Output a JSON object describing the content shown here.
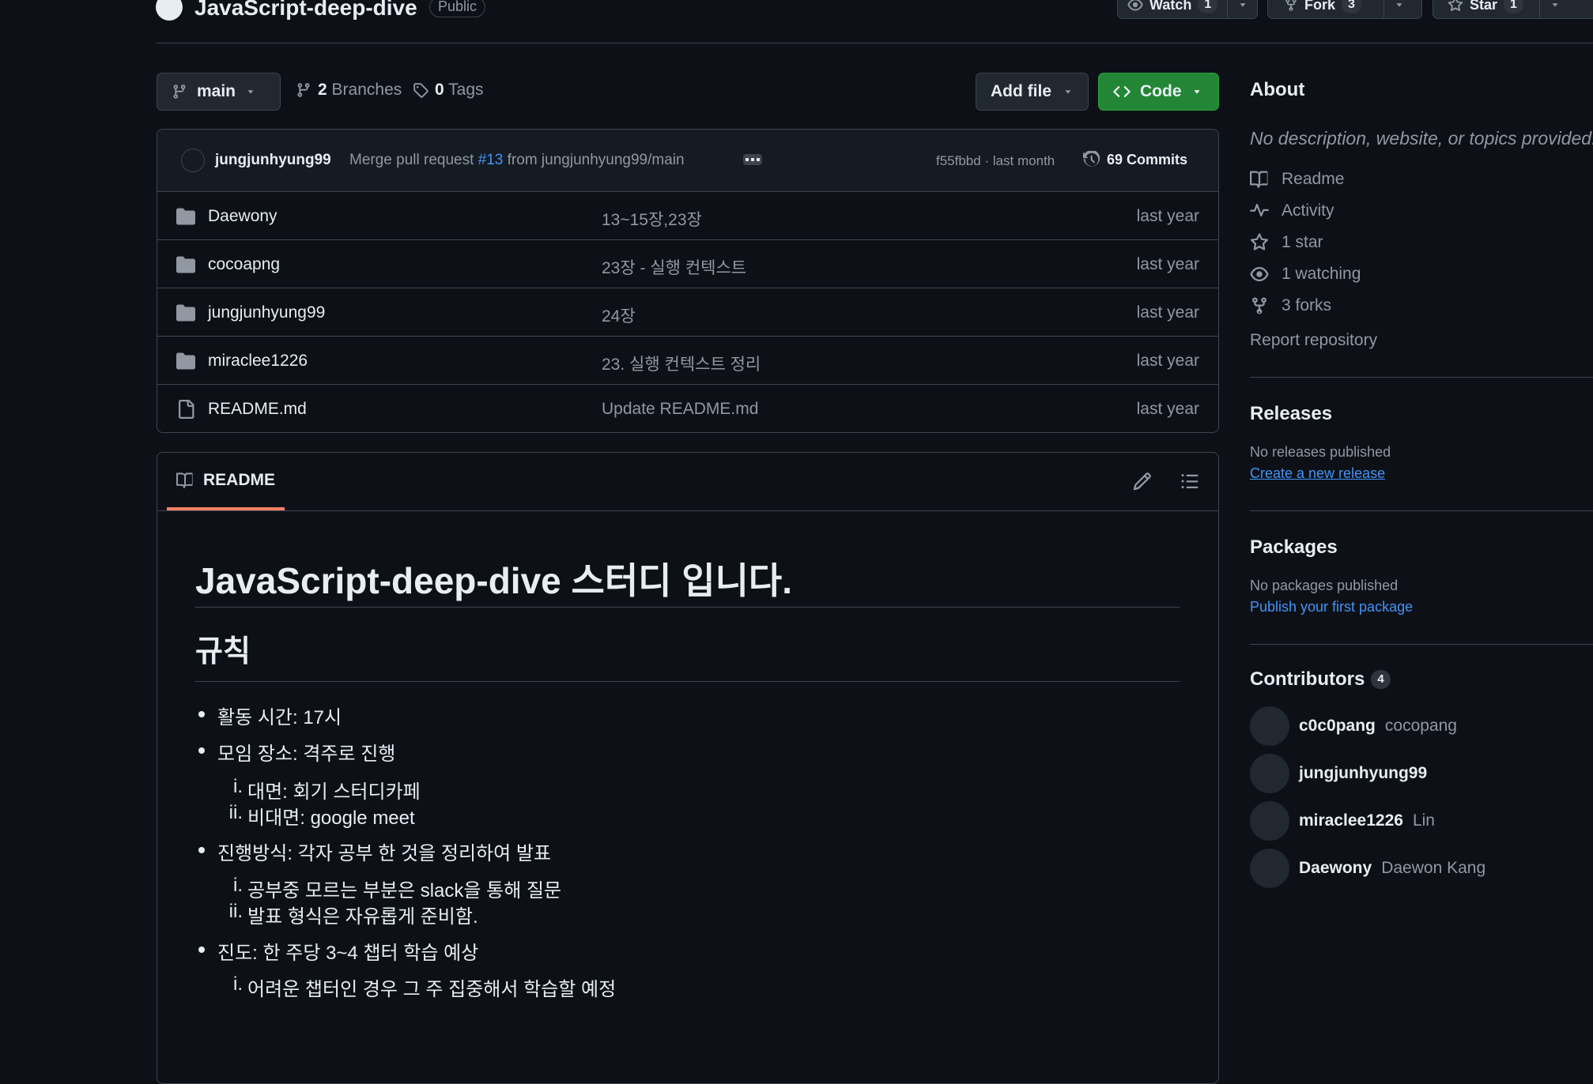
{
  "repo": {
    "name": "JavaScript-deep-dive",
    "visibility": "Public",
    "watch": {
      "label": "Watch",
      "count": "1"
    },
    "fork": {
      "label": "Fork",
      "count": "3"
    },
    "star": {
      "label": "Star",
      "count": "1"
    }
  },
  "toolbar": {
    "branch": "main",
    "branches_count": "2",
    "branches_label": "Branches",
    "tags_count": "0",
    "tags_label": "Tags",
    "add_file": "Add file",
    "code": "Code"
  },
  "latest_commit": {
    "author": "jungjunhyung99",
    "message_prefix": "Merge pull request",
    "pr": "#13",
    "message_suffix": "from jungjunhyung99/main",
    "hash_time": "f55fbbd · last month",
    "commits_label": "69 Commits"
  },
  "files": [
    {
      "name": "Daewony",
      "type": "dir",
      "commit": "13~15장,23장",
      "date": "last year"
    },
    {
      "name": "cocoapng",
      "type": "dir",
      "commit": "23장 - 실행 컨텍스트",
      "date": "last year"
    },
    {
      "name": "jungjunhyung99",
      "type": "dir",
      "commit": "24장",
      "date": "last year"
    },
    {
      "name": "miraclee1226",
      "type": "dir",
      "commit": "23. 실행 컨텍스트 정리",
      "date": "last year"
    },
    {
      "name": "README.md",
      "type": "file",
      "commit": "Update README.md",
      "date": "last year"
    }
  ],
  "readme": {
    "tab": "README",
    "h1": "JavaScript-deep-dive 스터디 입니다.",
    "h2": "규칙",
    "items": [
      {
        "text": "활동 시간: 17시"
      },
      {
        "text": "모임 장소: 격주로 진행",
        "sub": [
          {
            "n": "i.",
            "text": "대면: 회기 스터디카페"
          },
          {
            "n": "ii.",
            "text": "비대면: google meet"
          }
        ]
      },
      {
        "text": "진행방식: 각자 공부 한 것을 정리하여 발표",
        "sub": [
          {
            "n": "i.",
            "text": "공부중 모르는 부분은 slack을 통해 질문"
          },
          {
            "n": "ii.",
            "text": "발표 형식은 자유롭게 준비함."
          }
        ]
      },
      {
        "text": "진도: 한 주당 3~4 챕터 학습 예상",
        "sub": [
          {
            "n": "i.",
            "text": "어려운 챕터인 경우 그 주 집중해서 학습할 예정"
          }
        ]
      }
    ]
  },
  "about": {
    "title": "About",
    "description": "No description, website, or topics provided.",
    "items": [
      {
        "icon": "book-icon",
        "label": "Readme"
      },
      {
        "icon": "pulse-icon",
        "label": "Activity"
      },
      {
        "icon": "star-icon",
        "label": "1 star"
      },
      {
        "icon": "eye-icon",
        "label": "1 watching"
      },
      {
        "icon": "fork-icon",
        "label": "3 forks"
      }
    ],
    "report": "Report repository"
  },
  "releases": {
    "title": "Releases",
    "empty": "No releases published",
    "link": "Create a new release"
  },
  "packages": {
    "title": "Packages",
    "empty": "No packages published",
    "link": "Publish your first package"
  },
  "contributors": {
    "title": "Contributors",
    "count": "4",
    "list": [
      {
        "login": "c0c0pang",
        "name": "cocopang"
      },
      {
        "login": "jungjunhyung99",
        "name": ""
      },
      {
        "login": "miraclee1226",
        "name": "Lin"
      },
      {
        "login": "Daewony",
        "name": "Daewon Kang"
      }
    ]
  },
  "colors": {
    "background": "#0d1117",
    "border": "#3d444d",
    "accent_green": "#238636",
    "link": "#4493f8",
    "tab_underline": "#f78166"
  }
}
